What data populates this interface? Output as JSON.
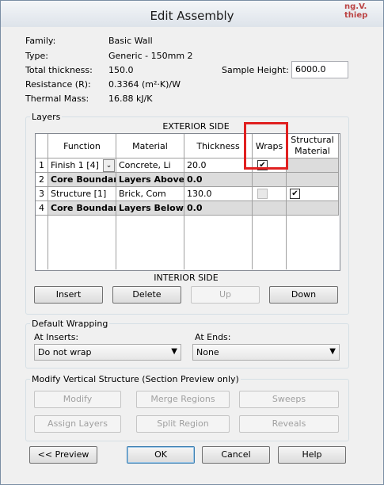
{
  "window": {
    "title": "Edit Assembly",
    "watermark_line1": "ng.V.",
    "watermark_line2": "thiep"
  },
  "props": {
    "family_label": "Family:",
    "family_value": "Basic Wall",
    "type_label": "Type:",
    "type_value": "Generic - 150mm 2",
    "thickness_label": "Total thickness:",
    "thickness_value": "150.0",
    "resistance_label": "Resistance (R):",
    "resistance_value": "0.3364 (m²·K)/W",
    "mass_label": "Thermal Mass:",
    "mass_value": "16.88 kJ/K",
    "sample_height_label": "Sample Height:",
    "sample_height_value": "6000.0"
  },
  "layers": {
    "group_label": "Layers",
    "exterior": "EXTERIOR SIDE",
    "interior": "INTERIOR SIDE",
    "headers": [
      "Function",
      "Material",
      "Thickness",
      "Wraps",
      "Structural Material"
    ],
    "rows": [
      {
        "num": "1",
        "function": "Finish 1 [4]",
        "material": "Concrete, Li",
        "thickness": "20.0",
        "wraps": true,
        "structural": null,
        "core": false
      },
      {
        "num": "2",
        "function": "Core Boundar",
        "material": "Layers Above",
        "thickness": "0.0",
        "wraps": null,
        "structural": null,
        "core": true
      },
      {
        "num": "3",
        "function": "Structure [1]",
        "material": "Brick, Com",
        "thickness": "130.0",
        "wraps": false,
        "structural": true,
        "core": false
      },
      {
        "num": "4",
        "function": "Core Boundar",
        "material": "Layers Below",
        "thickness": "0.0",
        "wraps": null,
        "structural": null,
        "core": true
      }
    ],
    "buttons": {
      "insert": "Insert",
      "delete": "Delete",
      "up": "Up",
      "down": "Down"
    },
    "checkmark": "✔"
  },
  "wrapping": {
    "group_label": "Default Wrapping",
    "inserts_label": "At Inserts:",
    "inserts_value": "Do not wrap",
    "ends_label": "At Ends:",
    "ends_value": "None"
  },
  "modify": {
    "group_label": "Modify Vertical Structure (Section Preview only)",
    "modify": "Modify",
    "merge": "Merge Regions",
    "sweeps": "Sweeps",
    "assign": "Assign Layers",
    "split": "Split Region",
    "reveals": "Reveals"
  },
  "footer": {
    "preview": "<< Preview",
    "ok": "OK",
    "cancel": "Cancel",
    "help": "Help"
  }
}
